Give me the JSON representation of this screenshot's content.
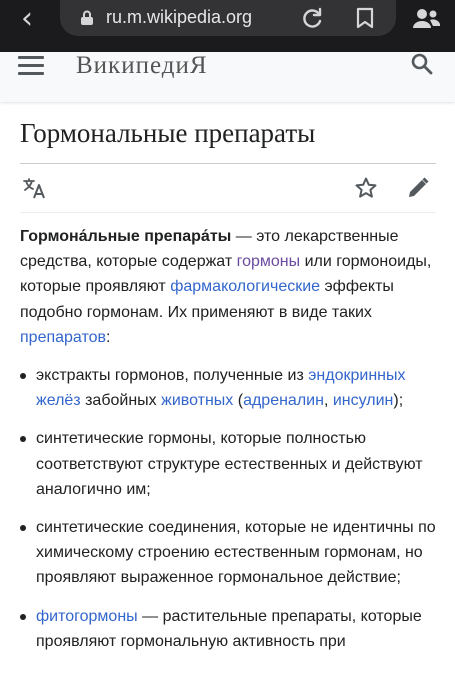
{
  "browser": {
    "back_icon": "chevron-left-icon",
    "url": "ru.m.wikipedia.org",
    "icons": [
      "lock-icon",
      "reload-icon",
      "bookmark-icon",
      "people-icon"
    ]
  },
  "header": {
    "logo": "ВикипедиЯ",
    "icons": [
      "menu-icon",
      "search-icon"
    ]
  },
  "article": {
    "title": "Гормональные препараты",
    "toolbar_icons": [
      "language-icon",
      "star-icon",
      "edit-icon"
    ],
    "intro": {
      "bold": "Гормона́льные препара́ты",
      "t1": " — это лекарственные средства, которые содержат ",
      "link_hormones": "гормоны",
      "t2": " или гормоноиды, которые проявляют ",
      "link_pharm": "фармакологические",
      "t3": " эффекты подобно гормонам. Их применяют в виде таких ",
      "link_preparations": "препаратов",
      "t4": ":"
    },
    "list": {
      "item1": {
        "t1": "экстракты гормонов, полученные из ",
        "link_glands": "эндокринных желёз",
        "t2": " забойных ",
        "link_animals": "животных",
        "t3": " (",
        "link_adrenaline": "адреналин",
        "t4": ", ",
        "link_insulin": "инсулин",
        "t5": ");"
      },
      "item2": "синтетические гормоны, которые полностью соответствуют структуре естественных и действуют аналогично им;",
      "item3": "синтетические соединения, которые не идентичны по химическому строению естественным гормонам, но проявляют выраженное гормональное действие;",
      "item4": {
        "link_phyto": "фитогормоны",
        "t1": " — растительные препараты, которые проявляют гормональную активность при"
      }
    }
  },
  "colors": {
    "link": "#3366cc",
    "visited_link": "#6b4ba1",
    "text": "#202122"
  }
}
